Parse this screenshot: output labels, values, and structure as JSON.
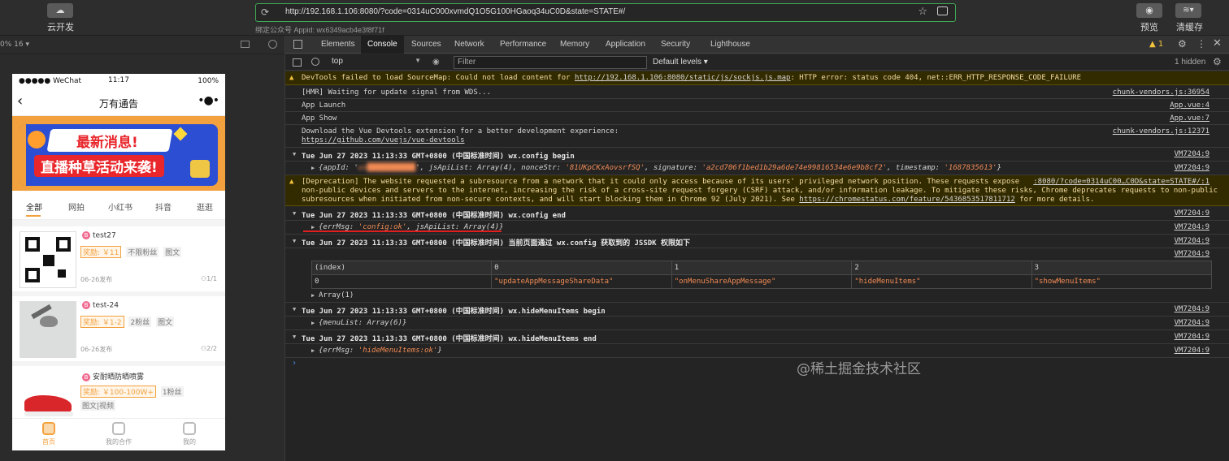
{
  "toolbar": {
    "cloud_label": "云开发",
    "url": "http://192.168.1.106:8080/?code=0314uC000xvmdQ1O5G100HGaoq34uC0D&state=STATE#/",
    "appid": "绑定公众号 Appid: wx6349acb4e3f8f71f",
    "preview_label": "预览",
    "cache_label": "清缓存"
  },
  "simulator": {
    "zoom": "0% 16 ▾",
    "status": {
      "carrier": "●●●●● WeChat",
      "time": "11:17",
      "battery": "100%"
    },
    "nav_title": "万有通告",
    "nav_back": "‹",
    "nav_more": "•●•",
    "banner": {
      "line1": "最新消息!",
      "line2": "直播种草活动来袭!"
    },
    "tabs": [
      "全部",
      "网拍",
      "小红书",
      "抖音",
      "逛逛"
    ],
    "tasks": [
      {
        "badge": "B",
        "name": "test27",
        "reward": "奖励: ￥11",
        "tags": [
          "不限粉丝",
          "图文"
        ],
        "date": "06-26发布",
        "count": "1/1"
      },
      {
        "badge": "B",
        "name": "test-24",
        "reward": "奖励: ￥1-2",
        "tags": [
          "2粉丝",
          "图文"
        ],
        "date": "06-26发布",
        "count": "2/2"
      },
      {
        "badge": "B",
        "name": "安耐晒防晒喷雾",
        "reward": "奖励: ￥100-100W+",
        "tags": [
          "1粉丝",
          "图文|视频"
        ],
        "date": "",
        "count": ""
      }
    ],
    "tabbar": [
      "首页",
      "我的合作",
      "我的"
    ]
  },
  "devtools": {
    "tabs": [
      "Elements",
      "Console",
      "Sources",
      "Network",
      "Performance",
      "Memory",
      "Application",
      "Security",
      "Lighthouse"
    ],
    "active_tab": "Console",
    "warn_count": "▲ 1",
    "context": "top",
    "filter_placeholder": "Filter",
    "levels": "Default levels ▾",
    "hidden": "1 hidden",
    "console": {
      "sourcemap_warn_pre": "DevTools failed to load SourceMap: Could not load content for ",
      "sourcemap_link": "http://192.168.1.106:8080/static/js/sockjs.js.map",
      "sourcemap_warn_post": ": HTTP error: status code 404, net::ERR_HTTP_RESPONSE_CODE_FAILURE",
      "hmr": "[HMR] Waiting for update signal from WDS...",
      "hmr_src": "chunk-vendors.js:36954",
      "launch": "App Launch",
      "launch_src": "App.vue:4",
      "show": "App Show",
      "show_src": "App.vue:7",
      "devtools_msg": "Download the Vue Devtools extension for a better development experience:",
      "devtools_link": "https://github.com/vuejs/vue-devtools",
      "devtools_src": "chunk-vendors.js:12371",
      "config_begin": "Tue Jun 27 2023 11:13:33 GMT+0800 (中国标准时间) wx.config begin",
      "vm_src": "VM7204:9",
      "vm_src2": "VM7204:1",
      "config_obj_a": "{appId: '",
      "config_obj_masked": "wx███████████",
      "config_obj_b": "', jsApiList: Array(4), nonceStr: ",
      "nonce": "'81UKpCKxAovsrfSQ'",
      "config_obj_c": ", signature: ",
      "signature": "'a2cd706f1bed1b29a6de74e99816534e6e9b8cf2'",
      "config_obj_d": ", timestamp: ",
      "timestamp": "'1687835613'",
      "config_obj_e": "}",
      "deprecation_1": "[Deprecation] The website requested a subresource from a network that it could only access because of its users' privileged network position. These requests expose",
      "deprecation_2": "non-public devices and servers to the internet, increasing the risk of a cross-site request forgery (CSRF) attack, and/or information leakage. To mitigate these risks, Chrome deprecates requests to non-public",
      "deprecation_3a": "subresources when initiated from non-secure contexts, and will start blocking them in Chrome 92 (July 2021). See ",
      "deprecation_link": "https://chromestatus.com/feature/5436853517811712",
      "deprecation_3b": " for more details.",
      "deprecation_src": ":8080/?code=0314uC00…C0D&state=STATE#/:1",
      "config_end": "Tue Jun 27 2023 11:13:33 GMT+0800 (中国标准时间) wx.config end",
      "end_obj_a": "{errMsg: ",
      "end_errmsg": "'config:ok'",
      "end_obj_b": ", jsApiList: Array(4)}",
      "jssdk": "Tue Jun 27 2023 11:13:33 GMT+0800 (中国标准时间) 当前页面通过 wx.config 获取到的 JSSDK 权限如下",
      "table_headers": [
        "(index)",
        "0",
        "1",
        "2",
        "3"
      ],
      "table_row": [
        "0",
        "\"updateAppMessageShareData\"",
        "\"onMenuShareAppMessage\"",
        "\"hideMenuItems\"",
        "\"showMenuItems\""
      ],
      "array_label": "Array(1)",
      "hide_begin": "Tue Jun 27 2023 11:13:33 GMT+0800 (中国标准时间) wx.hideMenuItems begin",
      "hide_begin_obj": "{menuList: Array(6)}",
      "hide_end": "Tue Jun 27 2023 11:13:33 GMT+0800 (中国标准时间) wx.hideMenuItems end",
      "hide_end_a": "{errMsg: ",
      "hide_end_err": "'hideMenuItems:ok'",
      "hide_end_b": "}",
      "prompt": "›"
    }
  },
  "watermark": "@稀土掘金技术社区"
}
